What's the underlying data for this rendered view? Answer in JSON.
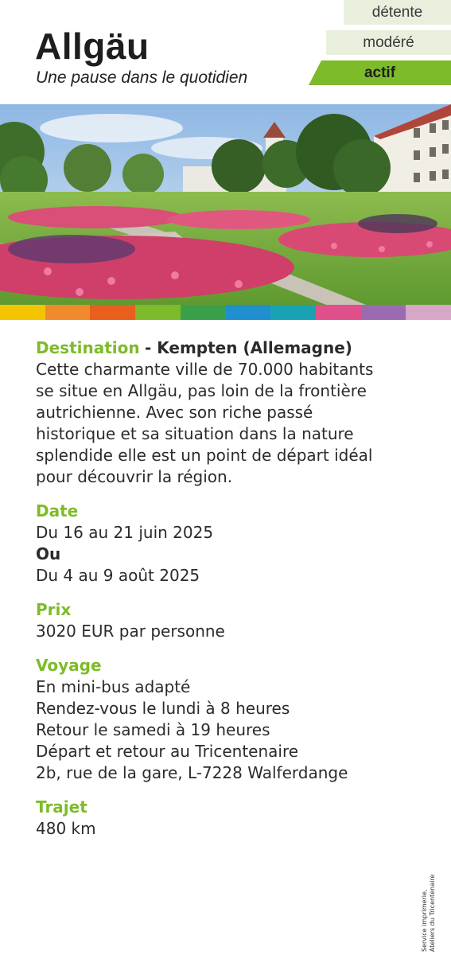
{
  "header": {
    "title": "Allgäu",
    "subtitle": "Une pause dans le quotidien",
    "levels": [
      {
        "label": "détente",
        "active": false
      },
      {
        "label": "modéré",
        "active": false
      },
      {
        "label": "actif",
        "active": true
      }
    ]
  },
  "stripe_colors": [
    "#f5c400",
    "#f08a2c",
    "#e85f1e",
    "#7dbb2a",
    "#3aa14a",
    "#1f8fce",
    "#17a3b4",
    "#e0508a",
    "#9b6bb1",
    "#d7a6c8"
  ],
  "destination": {
    "label": "Destination",
    "place": "- Kempten (Allemagne)",
    "lines": [
      "Cette charmante ville de 70.000 habitants",
      "se situe en Allgäu, pas loin de la frontière",
      "autrichienne. Avec son riche passé",
      "historique et sa situation dans la nature",
      "splendide elle est un point de départ idéal",
      "pour découvrir la région."
    ]
  },
  "date": {
    "label": "Date",
    "option1": "Du 16 au 21 juin 2025",
    "or": "Ou",
    "option2": "Du 4 au 9 août 2025"
  },
  "price": {
    "label": "Prix",
    "value": "3020 EUR par personne"
  },
  "travel": {
    "label": "Voyage",
    "lines": [
      "En mini-bus adapté",
      "Rendez-vous le lundi à 8 heures",
      "Retour le samedi à 19 heures",
      "Départ et retour au Tricentenaire",
      "2b, rue de la gare, L-7228 Walferdange"
    ]
  },
  "route": {
    "label": "Trajet",
    "value": "480 km"
  },
  "credit": {
    "line1": "Service imprimerie,",
    "line2": "Ateliers du Tricentenaire"
  }
}
